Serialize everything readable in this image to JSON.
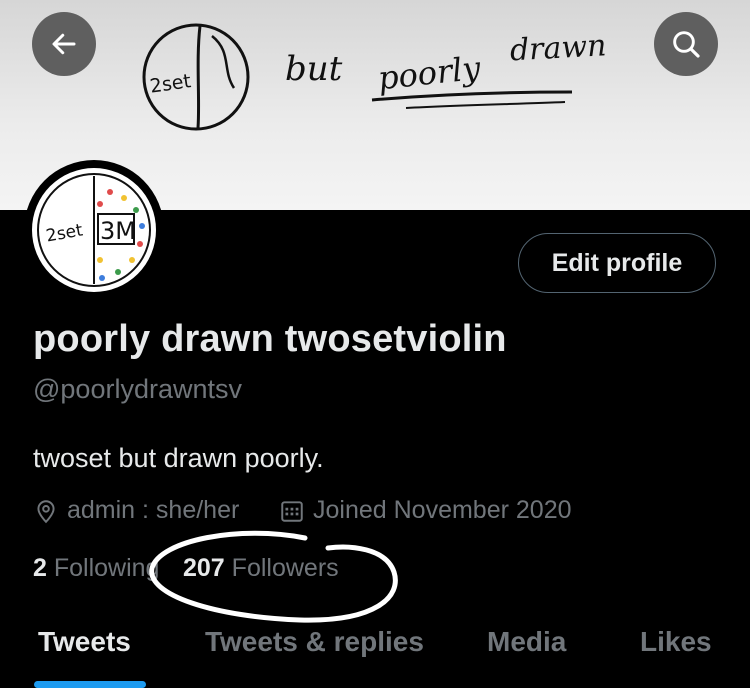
{
  "header": {
    "banner_text_1": "2set",
    "banner_text_2": "but",
    "banner_text_3": "poorly",
    "banner_text_4": "drawn"
  },
  "avatar": {
    "text_left": "2set",
    "text_right": "3M"
  },
  "edit_profile_label": "Edit profile",
  "profile": {
    "name": "poorly drawn twosetviolin",
    "handle": "@poorlydrawntsv",
    "bio": "twoset but drawn poorly.",
    "location": "admin : she/her",
    "joined": "Joined November 2020"
  },
  "stats": {
    "following_count": "2",
    "following_label": "Following",
    "followers_count": "207",
    "followers_label": "Followers"
  },
  "tabs": [
    "Tweets",
    "Tweets & replies",
    "Media",
    "Likes"
  ],
  "colors": {
    "accent": "#1d9bf0",
    "text_primary": "#e7e9ea",
    "text_secondary": "#71767b",
    "background": "#000000"
  }
}
